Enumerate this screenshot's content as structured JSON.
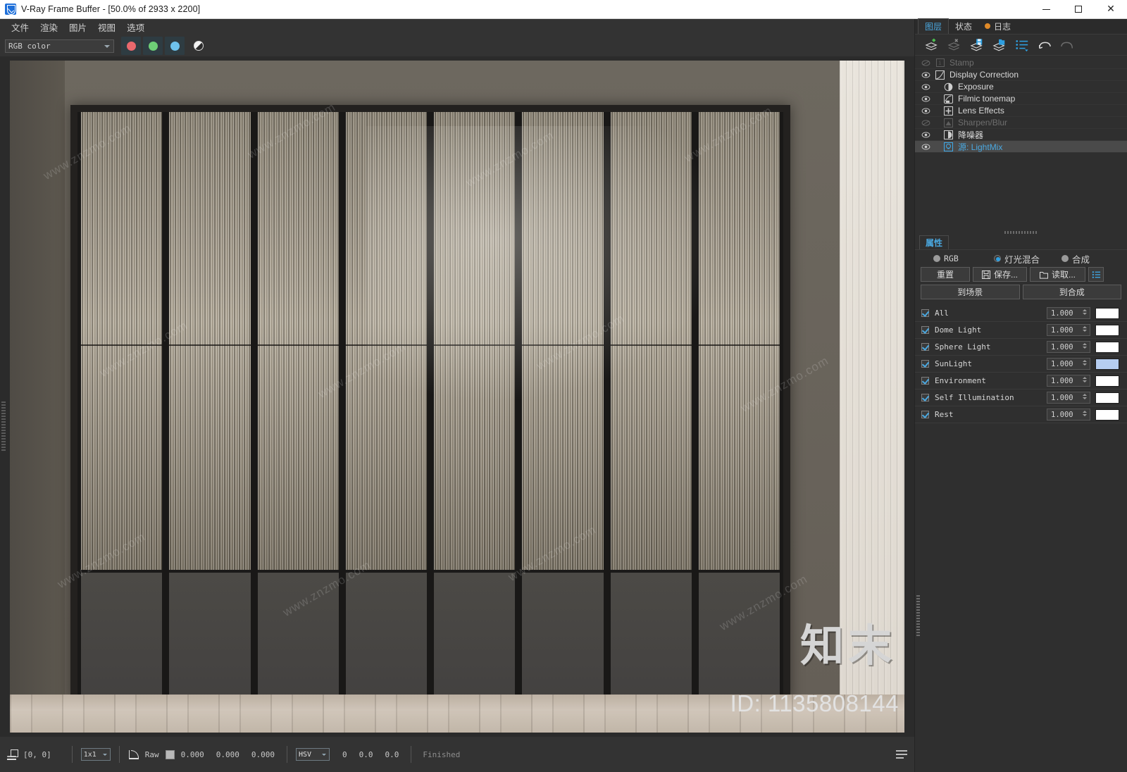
{
  "window": {
    "title": "V-Ray Frame Buffer - [50.0% of 2933 x 2200]",
    "app_icon": "vray-icon",
    "minimize": "minimize-icon",
    "maximize": "maximize-icon",
    "close": "close-icon"
  },
  "menu": {
    "items": [
      {
        "label": "文件"
      },
      {
        "label": "渲染"
      },
      {
        "label": "图片"
      },
      {
        "label": "视图"
      },
      {
        "label": "选项"
      }
    ]
  },
  "toolbar": {
    "channel_value": "RGB color",
    "channel_placeholder": "RGB color",
    "red_color": "#e8686d",
    "green_color": "#6ed077",
    "blue_color": "#6ec2ec",
    "right_buttons": [
      {
        "name": "save-image-icon"
      },
      {
        "name": "clear-image-icon"
      },
      {
        "name": "region-render-icon"
      },
      {
        "name": "fit-to-window-icon"
      },
      {
        "name": "render-start-icon"
      },
      {
        "name": "render-stop-icon"
      },
      {
        "name": "render-last-icon"
      }
    ]
  },
  "image": {
    "watermarks": [
      "www.znzmo.com",
      "www.znzmo.com",
      "www.znzmo.com",
      "www.znzmo.com",
      "www.znzmo.com",
      "www.znzmo.com",
      "www.znzmo.com",
      "www.znzmo.com",
      "www.znzmo.com",
      "www.znzmo.com",
      "www.znzmo.com",
      "www.znzmo.com"
    ],
    "logo_text": "知末",
    "id_text": "ID: 1135808144",
    "panel_count": 8
  },
  "statusbar": {
    "lock_icon": "pixel-lock-icon",
    "coords": "[0,  0]",
    "sample_size": "1x1",
    "curve_icon": "color-curve-icon",
    "mode": "Raw",
    "swatch_color": "#b9b9b9",
    "values": [
      "0.000",
      "0.000",
      "0.000"
    ],
    "color_space": "HSV",
    "hsv_values": [
      "0",
      "0.0",
      "0.0"
    ],
    "status": "Finished",
    "menu_icon": "list-menu-icon"
  },
  "dock": {
    "tabs": [
      {
        "label": "图层",
        "active": true
      },
      {
        "label": "状态",
        "active": false
      },
      {
        "label": "日志",
        "active": false,
        "dot": true
      }
    ],
    "layer_toolbar": [
      {
        "name": "add-layer-icon"
      },
      {
        "name": "delete-layer-icon"
      },
      {
        "name": "save-layer-icon"
      },
      {
        "name": "load-layer-icon"
      },
      {
        "name": "layer-presets-icon"
      },
      {
        "name": "undo-icon"
      },
      {
        "name": "redo-icon"
      }
    ],
    "layers": [
      {
        "label": "Stamp",
        "icon": "stamp-icon",
        "visible": false,
        "enabled": false,
        "selected": false
      },
      {
        "label": "Display Correction",
        "icon": "curve-icon",
        "visible": true,
        "enabled": true,
        "selected": false
      },
      {
        "label": "Exposure",
        "icon": "exposure-icon",
        "visible": true,
        "enabled": true,
        "selected": false,
        "indent": true
      },
      {
        "label": "Filmic tonemap",
        "icon": "tonemap-icon",
        "visible": true,
        "enabled": true,
        "selected": false,
        "indent": true
      },
      {
        "label": "Lens Effects",
        "icon": "lens-effects-icon",
        "visible": true,
        "enabled": true,
        "selected": false,
        "indent": true
      },
      {
        "label": "Sharpen/Blur",
        "icon": "sharpen-blur-icon",
        "visible": false,
        "enabled": false,
        "selected": false,
        "indent": true
      },
      {
        "label": "降噪器",
        "icon": "denoiser-icon",
        "visible": true,
        "enabled": true,
        "selected": false,
        "indent": true
      },
      {
        "label": "源: LightMix",
        "icon": "lightmix-icon",
        "visible": true,
        "enabled": true,
        "selected": true,
        "indent": true
      }
    ],
    "properties": {
      "tab_label": "属性",
      "modes": [
        {
          "label": "RGB",
          "selected": false
        },
        {
          "label": "灯光混合",
          "selected": true
        },
        {
          "label": "合成",
          "selected": false
        }
      ],
      "buttons_row1": [
        {
          "label": "重置",
          "icon": null
        },
        {
          "label": "保存...",
          "icon": "save-icon"
        },
        {
          "label": "读取...",
          "icon": "folder-icon"
        },
        {
          "label": "",
          "icon": "options-list-icon"
        }
      ],
      "buttons_row2": [
        {
          "label": "到场景"
        },
        {
          "label": "到合成"
        }
      ],
      "lightmix_rows": [
        {
          "name": "All",
          "checked": true,
          "value": "1.000",
          "color": "#ffffff"
        },
        {
          "name": "Dome Light",
          "checked": true,
          "value": "1.000",
          "color": "#ffffff"
        },
        {
          "name": "Sphere Light",
          "checked": true,
          "value": "1.000",
          "color": "#ffffff"
        },
        {
          "name": "SunLight",
          "checked": true,
          "value": "1.000",
          "color": "#b6cdf0"
        },
        {
          "name": "Environment",
          "checked": true,
          "value": "1.000",
          "color": "#ffffff"
        },
        {
          "name": "Self Illumination",
          "checked": true,
          "value": "1.000",
          "color": "#ffffff"
        },
        {
          "name": "Rest",
          "checked": true,
          "value": "1.000",
          "color": "#ffffff"
        }
      ]
    }
  }
}
